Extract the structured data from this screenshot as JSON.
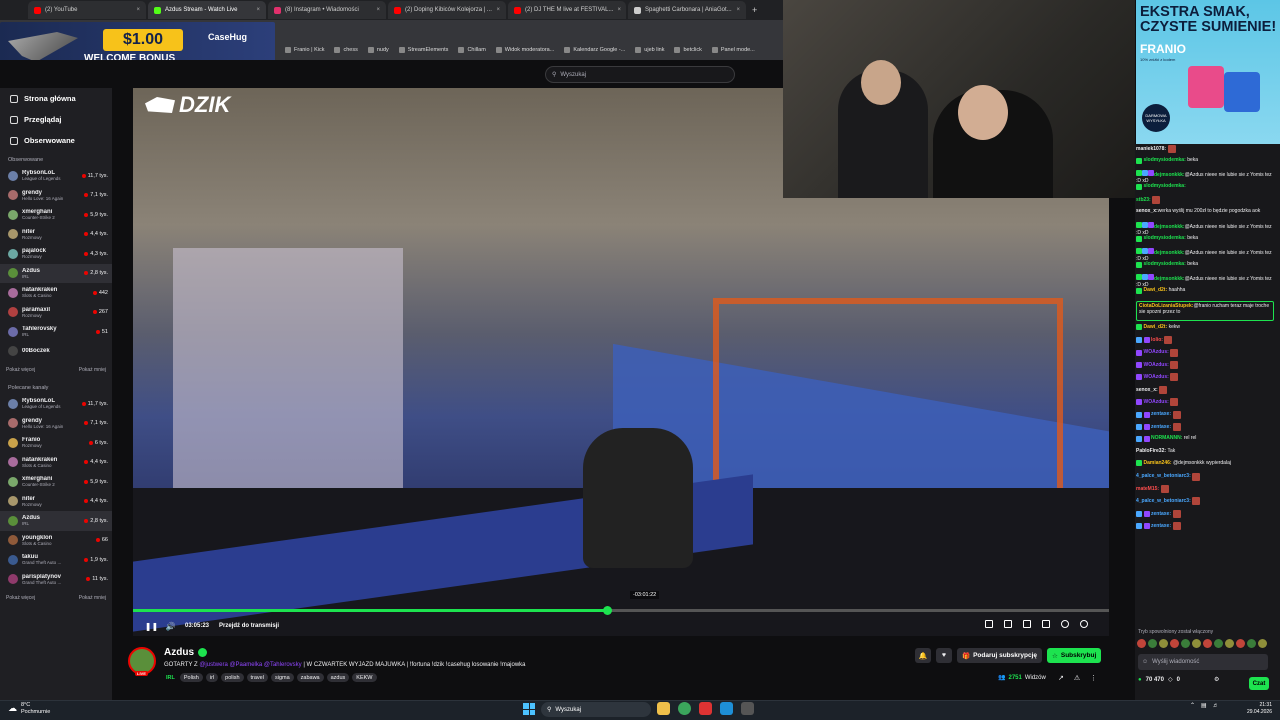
{
  "browser": {
    "tabs": [
      {
        "label": "(2) YouTube",
        "color": "#ff0000",
        "active": false
      },
      {
        "label": "Azdus Stream - Watch Live",
        "color": "#53fc18",
        "active": true
      },
      {
        "label": "(8) Instagram • Wiadomości",
        "color": "#e1306c",
        "active": false
      },
      {
        "label": "(2) Doping Kibiców Kolejorza | ...",
        "color": "#ff0000",
        "active": false
      },
      {
        "label": "(2) DJ THE M live at FESTIVAL...",
        "color": "#ff0000",
        "active": false
      },
      {
        "label": "Spaghetti Carbonara | AniaGot...",
        "color": "#cccccc",
        "active": false
      }
    ],
    "bookmarks": [
      "Franio | Kick",
      "chess",
      "nudy",
      "StreamElements",
      "Chillam",
      "Widok moderatora...",
      "Kalendarz Google -...",
      "ujeb link",
      "betclick",
      "Panel mode..."
    ],
    "promo": {
      "amount": "$1.00",
      "bonus": "WELCOME BONUS",
      "brand": "CaseHug"
    }
  },
  "search": {
    "placeholder": "Wyszukaj"
  },
  "sidebar": {
    "nav": [
      {
        "label": "Strona główna"
      },
      {
        "label": "Przeglądaj"
      },
      {
        "label": "Obserwowane"
      }
    ],
    "followed_header": "Obserwowane",
    "followed": [
      {
        "name": "RybsonLoL",
        "game": "League of Legends",
        "viewers": "11,7 tys.",
        "color": "#6b7fa8"
      },
      {
        "name": "grendy",
        "game": "Hello Love: 16 Again",
        "viewers": "7,1 tys.",
        "color": "#a86b6b"
      },
      {
        "name": "xmerghani",
        "game": "Counter-Strike 2",
        "viewers": "5,9 tys.",
        "color": "#7aa86b"
      },
      {
        "name": "niter",
        "game": "Rozmowy",
        "viewers": "4,4 tys.",
        "color": "#a8976b"
      },
      {
        "name": "pajalock",
        "game": "Rozmowy",
        "viewers": "4,3 tys.",
        "color": "#6ba8a3"
      },
      {
        "name": "Azdus",
        "game": "IRL",
        "viewers": "2,8 tys.",
        "color": "#5a8f3a"
      },
      {
        "name": "natankraken",
        "game": "Slots & Casino",
        "viewers": "442",
        "color": "#a86b9c"
      },
      {
        "name": "paramaxil",
        "game": "Rozmowy",
        "viewers": "267",
        "color": "#b04040"
      },
      {
        "name": "Tahlerovsky",
        "game": "IRL",
        "viewers": "51",
        "color": "#6b6ba8"
      },
      {
        "name": "00Boczek",
        "game": "",
        "viewers": "",
        "color": "#444"
      }
    ],
    "show_more": "Pokaż więcej",
    "show_less": "Pokaż mniej",
    "recommended_header": "Polecane kanały",
    "recommended": [
      {
        "name": "RybsonLoL",
        "game": "League of Legends",
        "viewers": "11,7 tys.",
        "color": "#6b7fa8"
      },
      {
        "name": "grendy",
        "game": "Hello Love: 16 Again",
        "viewers": "7,1 tys.",
        "color": "#a86b6b"
      },
      {
        "name": "Franio",
        "game": "Rozmowy",
        "viewers": "6 tys.",
        "color": "#c9a24a"
      },
      {
        "name": "natankraken",
        "game": "Slots & Casino",
        "viewers": "4,4 tys.",
        "color": "#a86b9c"
      },
      {
        "name": "xmerghani",
        "game": "Counter-Strike 2",
        "viewers": "5,9 tys.",
        "color": "#7aa86b"
      },
      {
        "name": "niter",
        "game": "Rozmowy",
        "viewers": "4,4 tys.",
        "color": "#a8976b"
      },
      {
        "name": "Azdus",
        "game": "IRL",
        "viewers": "2,8 tys.",
        "color": "#5a8f3a"
      },
      {
        "name": "youngklon",
        "game": "Slots & Casino",
        "viewers": "66",
        "color": "#8f5a3a"
      },
      {
        "name": "takuu",
        "game": "Grand Theft Auto ...",
        "viewers": "1,9 tys.",
        "color": "#3a5a8f"
      },
      {
        "name": "parisplatynov",
        "game": "Grand Theft Auto ...",
        "viewers": "11 tys.",
        "color": "#8f3a6b"
      }
    ]
  },
  "video": {
    "logo": "DZIK",
    "elapsed": "03:05:23",
    "hover_time": "-03:01:22",
    "go_live": "Przejdź do transmisji",
    "progress": 0.486
  },
  "ad": {
    "line1": "EKSTRA SMAK,",
    "line2": "CZYSTE SUMIENIE!",
    "brand": "FRANIO",
    "fine": "10% zniżki z kodem",
    "badge": "DARMOWA WYSYŁKA"
  },
  "stream": {
    "name": "Azdus",
    "live": "LIVE",
    "title_pre": "GOTARTY Z ",
    "title_mentions": "@justwera @Paamelka @Tahlerovsky",
    "title_post": " | W CZWARTEK WYJAZD MAJUWKA | !fortuna !dzik !casehug losowanie !majowka",
    "category": "IRL",
    "tags": [
      "Polish",
      "irl",
      "polish",
      "travel",
      "sigma",
      "zabawa",
      "azdus",
      "KEKW"
    ],
    "gift_label": "Podaruj subskrypcję",
    "subscribe_label": "Subskrybuj",
    "viewers": "2751",
    "viewers_label": "Widzów"
  },
  "chat": {
    "messages": [
      {
        "user": "maniek1078:",
        "text": "",
        "color": "#efeff1",
        "badges": [],
        "emote": true
      },
      {
        "user": "slodmysiodemka:",
        "text": "beka",
        "color": "#1de34f",
        "badges": [
          "#1de34f"
        ],
        "emote": false
      },
      {
        "user": "dejmsonkkk:",
        "text": "@Azdus nieee nie lubie sie z Yomis tez :D xD",
        "color": "#1de34f",
        "badges": [
          "#1de34f",
          "#4aa8ff",
          "#9147ff"
        ],
        "emote": false
      },
      {
        "user": "slodmysiodemka:",
        "text": "",
        "color": "#1de34f",
        "badges": [
          "#1de34f"
        ],
        "emote": false
      },
      {
        "user": "stb23:",
        "text": "",
        "color": "#1de34f",
        "badges": [],
        "emote": true
      },
      {
        "user": "senox_x:",
        "text": "werka wyślij mu 200zł to będzie pogodzka aok",
        "color": "#efeff1",
        "badges": [],
        "emote": false
      },
      {
        "user": "dejmsonkkk:",
        "text": "@Azdus nieee nie lubie sie z Yomis tez :D xD",
        "color": "#1de34f",
        "badges": [
          "#1de34f",
          "#4aa8ff",
          "#9147ff"
        ],
        "emote": false
      },
      {
        "user": "slodmysiodemka:",
        "text": "beka",
        "color": "#1de34f",
        "badges": [
          "#1de34f"
        ],
        "emote": false
      },
      {
        "user": "dejmsonkkk:",
        "text": "@Azdus nieee nie lubie sie z Yomis tez :D xD",
        "color": "#1de34f",
        "badges": [
          "#1de34f",
          "#4aa8ff",
          "#9147ff"
        ],
        "emote": false
      },
      {
        "user": "slodmysiodemka:",
        "text": "beka",
        "color": "#1de34f",
        "badges": [
          "#1de34f"
        ],
        "emote": false
      },
      {
        "user": "dejmsonkkk:",
        "text": "@Azdus nieee nie lubie sie z Yomis tez :D xD",
        "color": "#1de34f",
        "badges": [
          "#1de34f",
          "#4aa8ff",
          "#9147ff"
        ],
        "emote": false
      },
      {
        "user": "Dawi_d2t:",
        "text": "haahha",
        "color": "#f7c21a",
        "badges": [
          "#1de34f"
        ],
        "emote": false
      }
    ],
    "highlight": {
      "user": "CiotaDoLizaniaStupek:",
      "text": "@franio rucham teraz maje troche sie spozni przez to"
    },
    "messages2": [
      {
        "user": "Dawi_d2t:",
        "text": "kekw",
        "color": "#f7c21a",
        "badges": [
          "#1de34f"
        ],
        "emote": false
      },
      {
        "user": "lolio:",
        "text": "",
        "color": "#ff4d4d",
        "badges": [
          "#4aa8ff",
          "#9147ff"
        ],
        "emote": true
      },
      {
        "user": "WOAzdus:",
        "text": "",
        "color": "#9147ff",
        "badges": [
          "#9147ff"
        ],
        "emote": true
      },
      {
        "user": "WOAzdus:",
        "text": "",
        "color": "#9147ff",
        "badges": [
          "#9147ff"
        ],
        "emote": true
      },
      {
        "user": "WOAzdus:",
        "text": "",
        "color": "#9147ff",
        "badges": [
          "#9147ff"
        ],
        "emote": true
      },
      {
        "user": "senox_x:",
        "text": "",
        "color": "#efeff1",
        "badges": [],
        "emote": true
      },
      {
        "user": "WOAzdus:",
        "text": "",
        "color": "#9147ff",
        "badges": [
          "#9147ff"
        ],
        "emote": true
      },
      {
        "user": "zentaxe:",
        "text": "",
        "color": "#4aa8ff",
        "badges": [
          "#4aa8ff",
          "#9147ff"
        ],
        "emote": true
      },
      {
        "user": "zentaxe:",
        "text": "",
        "color": "#4aa8ff",
        "badges": [
          "#4aa8ff",
          "#9147ff"
        ],
        "emote": true
      },
      {
        "user": "NORMANNN:",
        "text": "rel rel",
        "color": "#1de34f",
        "badges": [
          "#4aa8ff",
          "#9147ff"
        ],
        "emote": false
      },
      {
        "user": "PabloFire32:",
        "text": "Tak",
        "color": "#efeff1",
        "badges": [],
        "emote": false
      },
      {
        "user": "Damian246:",
        "text": "@dejmsonkkk wypierdalaj",
        "color": "#f7c21a",
        "badges": [
          "#1de34f"
        ],
        "emote": false
      },
      {
        "user": "4_palce_w_betoniarc3:",
        "text": "",
        "color": "#4aa8ff",
        "badges": [],
        "emote": true
      },
      {
        "user": "mateM15:",
        "text": "",
        "color": "#ff4d4d",
        "badges": [],
        "emote": true
      },
      {
        "user": "4_palce_w_betoniarc3:",
        "text": "",
        "color": "#4aa8ff",
        "badges": [],
        "emote": true
      },
      {
        "user": "zentaxe:",
        "text": "",
        "color": "#4aa8ff",
        "badges": [
          "#4aa8ff",
          "#9147ff"
        ],
        "emote": true
      },
      {
        "user": "zentaxe:",
        "text": "",
        "color": "#4aa8ff",
        "badges": [
          "#4aa8ff",
          "#9147ff"
        ],
        "emote": true
      }
    ],
    "mode_note": "Tryb spowolniony został włączony",
    "input_placeholder": "Wyślij wiadomość",
    "points": "70 470",
    "zero": "0",
    "send_label": "Czat"
  },
  "taskbar": {
    "temp": "8°C",
    "weather": "Pochmurnie",
    "search": "Wyszukaj",
    "time": "21:31",
    "date": "29.04.2026"
  },
  "colors": {
    "accent": "#53fc18",
    "bg": "#0e0e10",
    "panel": "#18181b"
  }
}
